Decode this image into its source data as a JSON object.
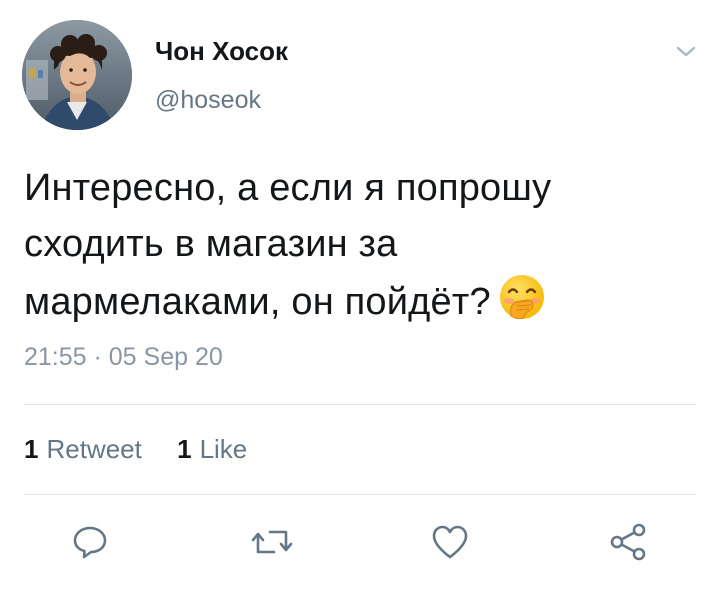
{
  "user": {
    "display_name": "Чон Хосок",
    "handle": "@hoseok"
  },
  "tweet": {
    "text_lines": [
      "Интересно, а если я попрошу",
      "сходить в магазин за",
      "мармелаками, он пойдёт?"
    ],
    "emoji": "face-with-hand-over-mouth",
    "timestamp": "21:55 · 05 Sep 20"
  },
  "stats": {
    "retweets_count": "1",
    "retweets_label": "Retweet",
    "likes_count": "1",
    "likes_label": "Like"
  },
  "actions": {
    "reply_icon": "reply-icon",
    "retweet_icon": "retweet-icon",
    "like_icon": "heart-icon",
    "share_icon": "share-icon"
  },
  "colors": {
    "text_primary": "#14171a",
    "text_secondary": "#657786",
    "icon_gray": "#657786",
    "divider": "#e1e8ed"
  }
}
